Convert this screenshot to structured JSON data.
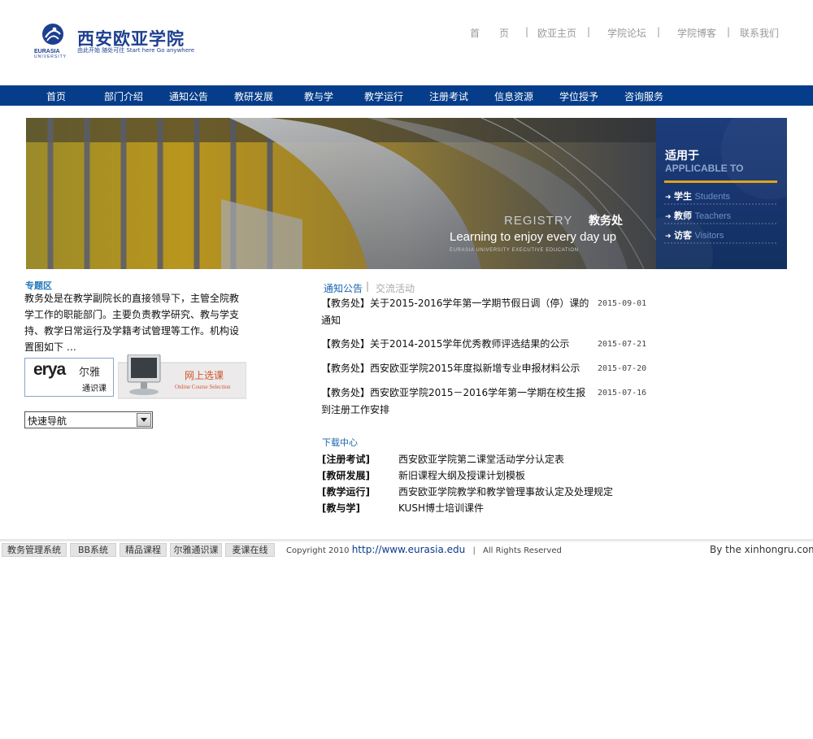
{
  "header": {
    "logo_cn": "西安欧亚学院",
    "logo_en": "EURASIA",
    "logo_en2": "UNIVERSITY",
    "logo_slogan": "由此开始 随处可往 Start here Go anywhere",
    "toplinks": [
      "首　　页",
      "|",
      "欧亚主页",
      "|",
      "学院论坛",
      "|",
      "学院博客",
      "|",
      "联系我们"
    ]
  },
  "nav": {
    "items": [
      "首页",
      "部门介绍",
      "通知公告",
      "教研发展",
      "教与学",
      "教学运行",
      "注册考试",
      "信息资源",
      "学位授予",
      "咨询服务"
    ]
  },
  "banner": {
    "registry": "REGISTRY",
    "dept": "教务处",
    "tagline": "Learning to enjoy every day up",
    "sub": "EURASIA UNIVERSITY EXECUTIVE EDUCATION",
    "side_title_cn": "适用于",
    "side_title_en": "APPLICABLE TO",
    "side_items": [
      {
        "cn": "学生",
        "en": "Students"
      },
      {
        "cn": "教师",
        "en": "Teachers"
      },
      {
        "cn": "访客",
        "en": "Visitors"
      }
    ]
  },
  "left": {
    "special_title": "专题区",
    "intro": "教务处是在教学副院长的直接领导下，主管全院教学工作的职能部门。主要负责教学研究、教与学支持、教学日常运行及学籍考试管理等工作。机构设置图如下 …",
    "erya_logo": "erya",
    "erya_cn": "尔雅",
    "erya_sub": "通识课",
    "online_cn": "网上选课",
    "online_en": "Online Course Selection",
    "quicknav": "快速导航"
  },
  "notices": {
    "tab_active": "通知公告",
    "tab_sep": "|",
    "tab_inactive": "交流活动",
    "items": [
      {
        "title": "【教务处】关于2015-2016学年第一学期节假日调（停）课的通知",
        "date": "2015-09-01"
      },
      {
        "title": "【教务处】关于2014-2015学年优秀教师评选结果的公示",
        "date": "2015-07-21"
      },
      {
        "title": "【教务处】西安欧亚学院2015年度拟新增专业申报材料公示",
        "date": "2015-07-20"
      },
      {
        "title": "【教务处】西安欧亚学院2015－2016学年第一学期在校生报到注册工作安排",
        "date": "2015-07-16"
      }
    ]
  },
  "downloads": {
    "title": "下载中心",
    "items": [
      {
        "category": "[注册考试]",
        "name": "西安欧亚学院第二课堂活动学分认定表"
      },
      {
        "category": "[教研发展]",
        "name": "新旧课程大纲及授课计划模板"
      },
      {
        "category": "[教学运行]",
        "name": "西安欧亚学院教学和教学管理事故认定及处理规定"
      },
      {
        "category": "[教与学]",
        "name": "KUSH博士培训课件"
      }
    ]
  },
  "footer": {
    "buttons": [
      "教务管理系统",
      "BB系统",
      "精品课程",
      "尔雅通识课",
      "麦课在线"
    ],
    "copyright": "Copyright 2010",
    "url": "http://www.eurasia.edu",
    "sep": "|",
    "rights": "All Rights Reserved",
    "by": "By the xinhongru.com"
  },
  "colors": {
    "nav_bg": "#063d8a",
    "link_blue": "#1b64ae",
    "brand_blue": "#1d3f8f",
    "banner_side": "#17346d",
    "accent_gold": "#e0a21a"
  }
}
